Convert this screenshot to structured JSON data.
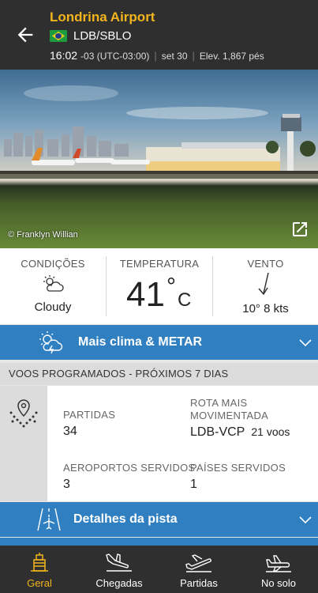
{
  "header": {
    "title": "Londrina Airport",
    "code": "LDB/SBLO",
    "time": "16:02",
    "timezone": "-03 (UTC-03:00)",
    "date": "set 30",
    "elevation": "Elev. 1,867 pés"
  },
  "hero": {
    "credit": "© Franklyn Willian"
  },
  "conditions": {
    "condition_label": "CONDIÇÕES",
    "condition_value": "Cloudy",
    "temp_label": "TEMPERATURA",
    "temp_value": "41",
    "temp_degree": "°",
    "temp_unit": "C",
    "wind_label": "VENTO",
    "wind_value": "10° 8 kts"
  },
  "weather_bar": {
    "label": "Mais clima & METAR"
  },
  "scheduled": {
    "heading": "VOOS PROGRAMADOS - PRÓXIMOS 7 DIAS",
    "departures_label": "PARTIDAS",
    "departures_value": "34",
    "busiest_label_1": "ROTA MAIS",
    "busiest_label_2": "MOVIMENTADA",
    "busiest_route": "LDB-VCP",
    "busiest_count": "21 voos",
    "airports_label": "AEROPORTOS SERVIDOS",
    "airports_value": "3",
    "countries_label": "PAÍSES SERVIDOS",
    "countries_value": "1"
  },
  "runway_bar": {
    "label": "Detalhes da pista"
  },
  "nav": [
    {
      "label": "Geral",
      "icon": "airport-icon",
      "active": true
    },
    {
      "label": "Chegadas",
      "icon": "arrival-plane-icon"
    },
    {
      "label": "Partidas",
      "icon": "departure-plane-icon"
    },
    {
      "label": "No solo",
      "icon": "ground-plane-icon"
    }
  ],
  "colors": {
    "accent": "#f2b51d",
    "bar_blue": "#2f7fc1",
    "header_bg": "#2f2f2f"
  }
}
